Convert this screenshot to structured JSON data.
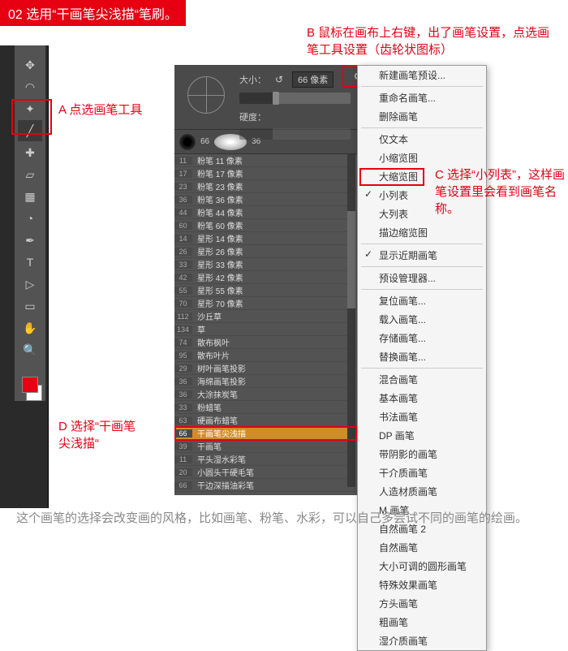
{
  "title": "02  选用“干画笔尖浅描“笔刷。",
  "annotations": {
    "A": "A 点选画笔工具",
    "B": "B 鼠标在画布上右键，出了画笔设置，点选画笔工具设置（齿轮状图标）",
    "C": "C 选择“小列表”，这样画笔设置里会看到画笔名称。",
    "D": "D 选择“干画笔\n尖浅描“"
  },
  "brush_panel": {
    "size_label": "大小：",
    "size_value": "66 像素",
    "hardness_label": "硬度：",
    "preview_nums": [
      "66",
      "",
      "36"
    ]
  },
  "brushes": [
    {
      "s": "11",
      "n": "粉笔 11 像素"
    },
    {
      "s": "17",
      "n": "粉笔 17 像素"
    },
    {
      "s": "23",
      "n": "粉笔 23 像素"
    },
    {
      "s": "36",
      "n": "粉笔 36 像素"
    },
    {
      "s": "44",
      "n": "粉笔 44 像素"
    },
    {
      "s": "60",
      "n": "粉笔 60 像素"
    },
    {
      "s": "14",
      "n": "星形 14 像素"
    },
    {
      "s": "26",
      "n": "星形 26 像素"
    },
    {
      "s": "33",
      "n": "星形 33 像素"
    },
    {
      "s": "42",
      "n": "星形 42 像素"
    },
    {
      "s": "55",
      "n": "星形 55 像素"
    },
    {
      "s": "70",
      "n": "星形 70 像素"
    },
    {
      "s": "112",
      "n": "沙丘草"
    },
    {
      "s": "134",
      "n": "草"
    },
    {
      "s": "74",
      "n": "散布枫叶"
    },
    {
      "s": "95",
      "n": "散布叶片"
    },
    {
      "s": "29",
      "n": "树叶画笔投影"
    },
    {
      "s": "36",
      "n": "海绵画笔投影"
    },
    {
      "s": "36",
      "n": "大涂抹炭笔"
    },
    {
      "s": "33",
      "n": "粉蜡笔"
    },
    {
      "s": "63",
      "n": "硬画布蜡笔"
    },
    {
      "s": "66",
      "n": "干画笔尖浅描",
      "sel": true
    },
    {
      "s": "39",
      "n": "干画笔"
    },
    {
      "s": "11",
      "n": "平头湿水彩笔"
    },
    {
      "s": "20",
      "n": "小圆头干硬毛笔"
    },
    {
      "s": "66",
      "n": "干边深描油彩笔"
    }
  ],
  "ctx_menu": [
    {
      "t": "新建画笔预设...",
      "type": "item"
    },
    {
      "type": "sep"
    },
    {
      "t": "重命名画笔...",
      "type": "item"
    },
    {
      "t": "删除画笔",
      "type": "item"
    },
    {
      "type": "sep"
    },
    {
      "t": "仅文本",
      "type": "item"
    },
    {
      "t": "小缩览图",
      "type": "item"
    },
    {
      "t": "大缩览图",
      "type": "item"
    },
    {
      "t": "小列表",
      "type": "item",
      "check": true
    },
    {
      "t": "大列表",
      "type": "item"
    },
    {
      "t": "描边缩览图",
      "type": "item"
    },
    {
      "type": "sep"
    },
    {
      "t": "显示近期画笔",
      "type": "item",
      "check": true
    },
    {
      "type": "sep"
    },
    {
      "t": "预设管理器...",
      "type": "item"
    },
    {
      "type": "sep"
    },
    {
      "t": "复位画笔...",
      "type": "item"
    },
    {
      "t": "载入画笔...",
      "type": "item"
    },
    {
      "t": "存储画笔...",
      "type": "item"
    },
    {
      "t": "替换画笔...",
      "type": "item"
    },
    {
      "type": "sep"
    },
    {
      "t": "混合画笔",
      "type": "item"
    },
    {
      "t": "基本画笔",
      "type": "item"
    },
    {
      "t": "书法画笔",
      "type": "item"
    },
    {
      "t": "DP 画笔",
      "type": "item"
    },
    {
      "t": "带阴影的画笔",
      "type": "item"
    },
    {
      "t": "干介质画笔",
      "type": "item"
    },
    {
      "t": "人造材质画笔",
      "type": "item"
    },
    {
      "t": "M 画笔",
      "type": "item"
    },
    {
      "t": "自然画笔 2",
      "type": "item"
    },
    {
      "t": "自然画笔",
      "type": "item"
    },
    {
      "t": "大小可调的圆形画笔",
      "type": "item"
    },
    {
      "t": "特殊效果画笔",
      "type": "item"
    },
    {
      "t": "方头画笔",
      "type": "item"
    },
    {
      "t": "粗画笔",
      "type": "item"
    },
    {
      "t": "湿介质画笔",
      "type": "item"
    }
  ],
  "bottom_text": "这个画笔的选择会改变画的风格，比如画笔、粉笔、水彩，可以自己多尝试不同的画笔的绘画。"
}
